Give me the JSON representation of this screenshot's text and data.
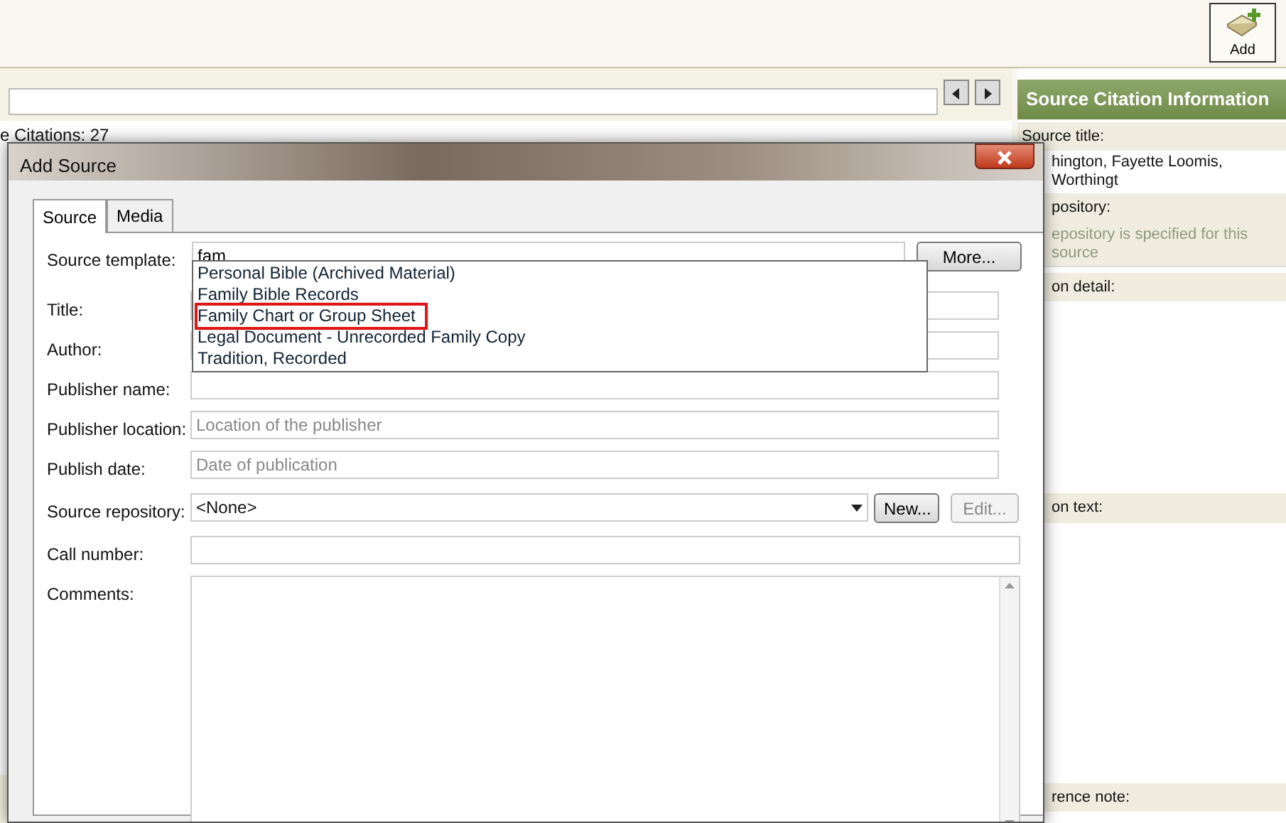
{
  "toolbar": {
    "add_button": "Add"
  },
  "left_panel": {
    "count_label": "e Citations: 27"
  },
  "right_panel": {
    "header": "Source Citation Information",
    "fields": [
      {
        "label": "Source title:",
        "value": "hington, Fayette Loomis, Worthingt"
      },
      {
        "label": "pository:",
        "note": "epository is specified for this source"
      },
      {
        "label": "on detail:"
      },
      {
        "label": "on text:"
      },
      {
        "label": "rence note:"
      }
    ]
  },
  "dialog": {
    "title": "Add Source",
    "tabs": [
      {
        "label": "Source",
        "selected": true
      },
      {
        "label": "Media",
        "selected": false
      }
    ],
    "rows": [
      {
        "kind": "template",
        "label": "Source template:",
        "value": "fam",
        "button": "More..."
      },
      {
        "kind": "text",
        "label": "Title:"
      },
      {
        "kind": "text",
        "label": "Author:"
      },
      {
        "kind": "text",
        "label": "Publisher name:"
      },
      {
        "kind": "text",
        "label": "Publisher location:",
        "placeholder": "Location of the publisher"
      },
      {
        "kind": "text",
        "label": "Publish date:",
        "placeholder": "Date of publication"
      },
      {
        "kind": "select",
        "label": "Source repository:",
        "value": "<None>",
        "buttons": [
          {
            "label": "New...",
            "disabled": false
          },
          {
            "label": "Edit...",
            "disabled": true
          }
        ]
      },
      {
        "kind": "wide",
        "label": "Call number:"
      },
      {
        "kind": "textarea",
        "label": "Comments:"
      }
    ],
    "suggestions": [
      {
        "label": "Personal Bible (Archived Material)",
        "highlighted": false
      },
      {
        "label": "Family Bible Records",
        "highlighted": false
      },
      {
        "label": "Family Chart or Group Sheet",
        "highlighted": true
      },
      {
        "label": "Legal Document - Unrecorded Family Copy",
        "highlighted": false
      },
      {
        "label": "Tradition, Recorded",
        "highlighted": false
      }
    ]
  }
}
